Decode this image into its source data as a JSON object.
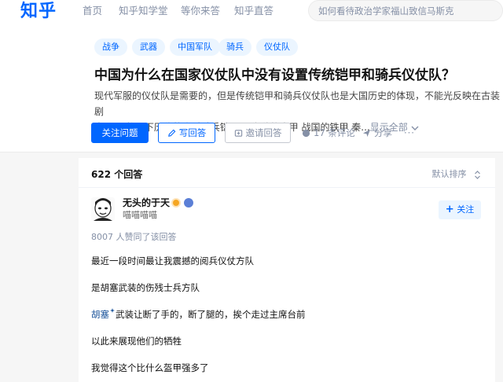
{
  "nav": {
    "logo": "知乎",
    "links": [
      "首页",
      "知乎知学堂",
      "等你来答",
      "知乎直答"
    ],
    "search_placeholder": "如何看待政治学家福山致信马斯克"
  },
  "question": {
    "tags": [
      "战争",
      "武器",
      "中国军队",
      "骑兵",
      "仪仗队"
    ],
    "title": "中国为什么在国家仪仗队中没有设置传统铠甲和骑兵仪仗队？",
    "description_line1": "现代军服的仪仗队是需要的，但是传统铠甲和骑兵仪仗队也是大国历史的体现，不能光反映在古装剧",
    "description_line2": "中。 历数以下历代的步兵骑兵铠甲： 春秋的皮甲 战国的铁甲 秦...",
    "show_all": "显示全部",
    "actions": {
      "follow": "关注问题",
      "write": "写回答",
      "invite": "邀请回答",
      "comments": "17 条评论",
      "share": "分享",
      "more": "···"
    }
  },
  "answers": {
    "count_label": "622 个回答",
    "sort_label": "默认排序",
    "author": {
      "name": "无头的于天",
      "bio": "喵喵喵喵",
      "follow_label": "关注"
    },
    "upvotes": "8007 人赞同了该回答",
    "paragraphs": [
      "最近一段时间最让我震撼的阅兵仪仗方队",
      "是胡塞武装的伤残士兵方队",
      "以此来展现他们的牺牲",
      "我觉得这个比什么盔甲强多了"
    ],
    "p3_link": "胡塞",
    "p3_rest": "武装让断了手的，断了腿的，挨个走过主席台前"
  },
  "colors": {
    "brand": "#0066ff",
    "tag_bg": "#ebf5ff",
    "muted": "#8590a6"
  }
}
